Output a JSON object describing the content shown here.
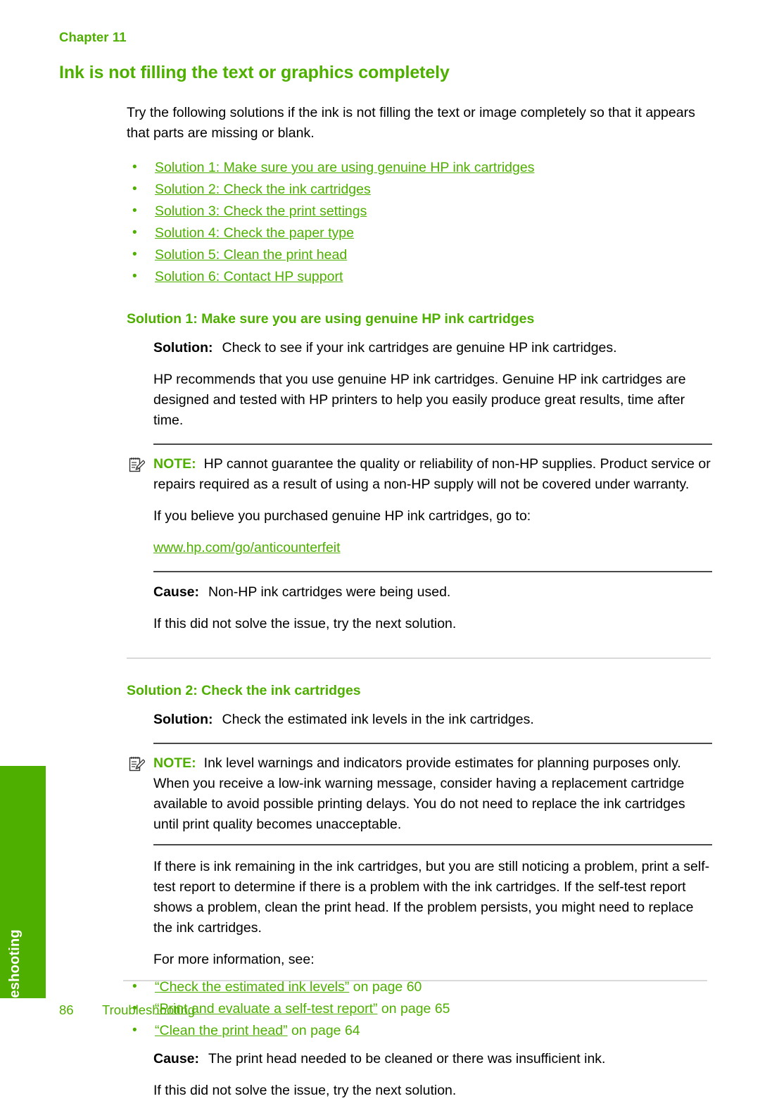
{
  "header": {
    "chapter": "Chapter 11"
  },
  "side_tab": {
    "label": "Troubleshooting"
  },
  "title": "Ink is not filling the text or graphics completely",
  "intro": "Try the following solutions if the ink is not filling the text or image completely so that it appears that parts are missing or blank.",
  "solution_links": [
    "Solution 1: Make sure you are using genuine HP ink cartridges",
    "Solution 2: Check the ink cartridges",
    "Solution 3: Check the print settings",
    "Solution 4: Check the paper type",
    "Solution 5: Clean the print head",
    "Solution 6: Contact HP support"
  ],
  "labels": {
    "solution": "Solution:",
    "cause": "Cause:",
    "note": "NOTE:"
  },
  "solution1": {
    "heading": "Solution 1: Make sure you are using genuine HP ink cartridges",
    "solution_text": "Check to see if your ink cartridges are genuine HP ink cartridges.",
    "paragraph": "HP recommends that you use genuine HP ink cartridges. Genuine HP ink cartridges are designed and tested with HP printers to help you easily produce great results, time after time.",
    "note_text": "HP cannot guarantee the quality or reliability of non-HP supplies. Product service or repairs required as a result of using a non-HP supply will not be covered under warranty.",
    "after_note": "If you believe you purchased genuine HP ink cartridges, go to:",
    "link": "www.hp.com/go/anticounterfeit",
    "cause_text": "Non-HP ink cartridges were being used.",
    "next_text": "If this did not solve the issue, try the next solution."
  },
  "solution2": {
    "heading": "Solution 2: Check the ink cartridges",
    "solution_text": "Check the estimated ink levels in the ink cartridges.",
    "note_text": "Ink level warnings and indicators provide estimates for planning purposes only. When you receive a low-ink warning message, consider having a replacement cartridge available to avoid possible printing delays. You do not need to replace the ink cartridges until print quality becomes unacceptable.",
    "paragraph": "If there is ink remaining in the ink cartridges, but you are still noticing a problem, print a self-test report to determine if there is a problem with the ink cartridges. If the self-test report shows a problem, clean the print head. If the problem persists, you might need to replace the ink cartridges.",
    "more_info": "For more information, see:",
    "references": [
      {
        "quoted": "“Check the estimated ink levels”",
        "page": " on page 60"
      },
      {
        "quoted": "“Print and evaluate a self-test report”",
        "page": " on page 65"
      },
      {
        "quoted": "“Clean the print head”",
        "page": " on page 64"
      }
    ],
    "cause_text": "The print head needed to be cleaned or there was insufficient ink.",
    "next_text": "If this did not solve the issue, try the next solution."
  },
  "footer": {
    "page_number": "86",
    "section": "Troubleshooting"
  },
  "colors": {
    "brand_green": "#4FAF00",
    "rule_dark": "#4a4a4a",
    "rule_light": "#d9d9d9"
  }
}
